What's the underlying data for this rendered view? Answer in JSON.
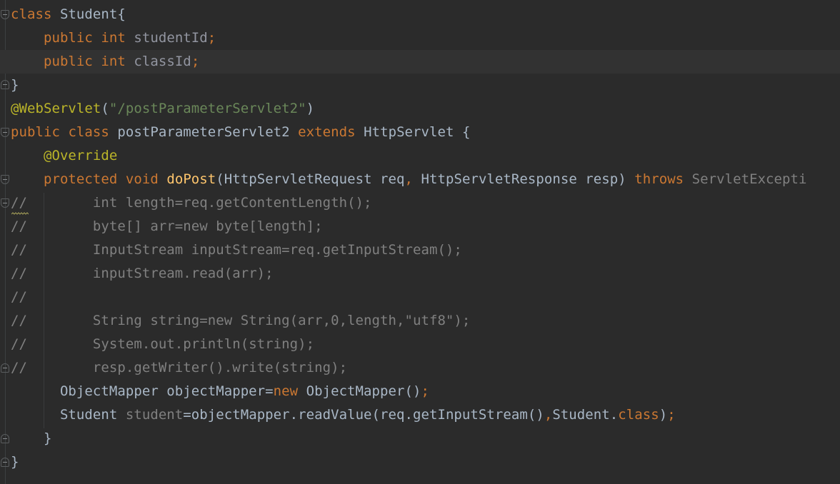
{
  "editor": {
    "lines": [
      "class Student{",
      "public int studentId;",
      "public int classId;",
      "}",
      "@WebServlet(\"/postParameterServlet2\")",
      "public class postParameterServlet2 extends HttpServlet {",
      "@Override",
      "protected void doPost(HttpServletRequest req, HttpServletResponse resp) throws ServletExcepti",
      "//       int length=req.getContentLength();",
      "//       byte[] arr=new byte[length];",
      "//       InputStream inputStream=req.getInputStream();",
      "//       inputStream.read(arr);",
      "//",
      "//       String string=new String(arr,0,length,\"utf8\");",
      "//       System.out.println(string);",
      "//       resp.getWriter().write(string);",
      "ObjectMapper objectMapper=new ObjectMapper();",
      "Student student=objectMapper.readValue(req.getInputStream(),Student.class);",
      "}",
      "}"
    ],
    "tokens": {
      "class": "class",
      "student_name": "Student{",
      "public": "public",
      "int": "int",
      "studentId": "studentId",
      "classId": "classId",
      "semicolon": ";",
      "brace_close": "}",
      "annotation": "@WebServlet",
      "paren_open": "(",
      "servlet_path": "\"/postParameterServlet2\"",
      "paren_close": ")",
      "servlet_class": "postParameterServlet2",
      "extends": "extends",
      "http_servlet_brace": "HttpServlet {",
      "override": "@Override",
      "protected": "protected",
      "void": "void",
      "do_post": "doPost",
      "do_post_params_a": "(HttpServletRequest req",
      "comma": ",",
      "do_post_params_b": " HttpServletResponse resp) ",
      "throws": "throws",
      "exception": " ServletExcepti",
      "comment_mark": "//",
      "c1": "int length=req.getContentLength();",
      "c2": "byte[] arr=new byte[length];",
      "c3": "InputStream inputStream=req.getInputStream();",
      "c4": "inputStream.read(arr);",
      "c6": "String string=new String(arr,0,length,\"utf8\");",
      "c7": "System.out.println(string);",
      "c8": "resp.getWriter().write(string);",
      "om_decl": "ObjectMapper objectMapper=",
      "new": "new",
      "om_ctor": " ObjectMapper()",
      "student_type": "Student ",
      "student_var": "student",
      "read_value": "=objectMapper.readValue(req.getInputStream()",
      "student_class_ref": "Student.",
      "class_kw": "class",
      "paren_semicolon_close": ");"
    }
  },
  "colors": {
    "background": "#2b2b2b",
    "keyword": "#cc7832",
    "string": "#6a8759",
    "annotation": "#bbb529",
    "method": "#ffc66d",
    "text": "#a9b7c6",
    "comment": "#808080"
  },
  "icons": {
    "intention": "lightbulb-icon",
    "fold": "fold-marker-icon"
  }
}
